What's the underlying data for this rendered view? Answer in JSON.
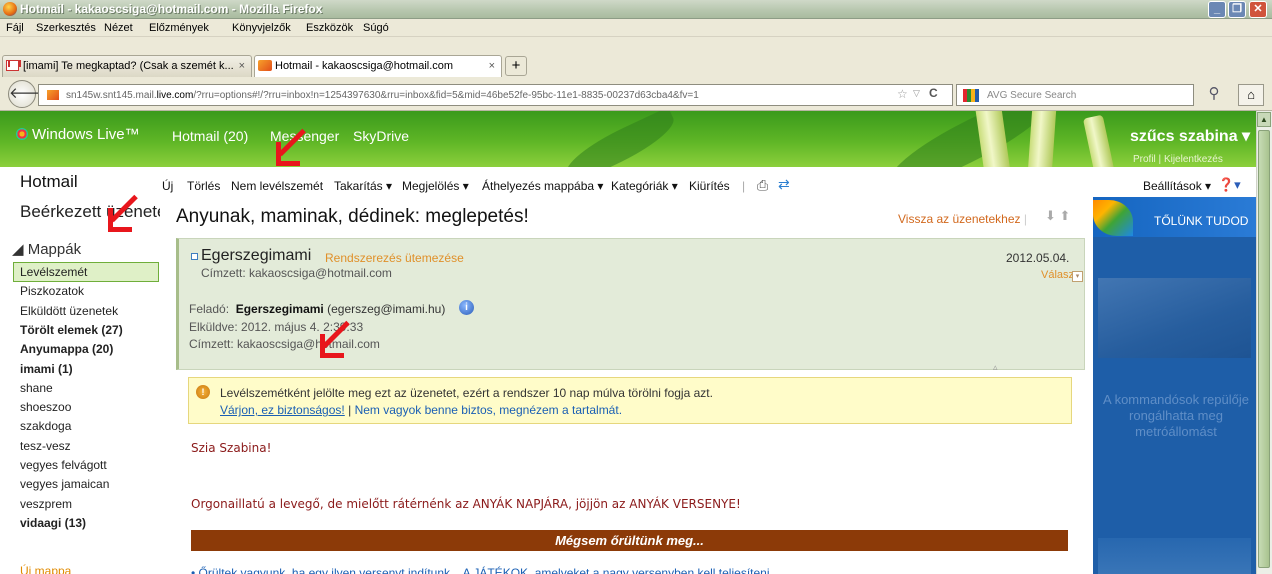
{
  "window": {
    "title": "Hotmail - kakaoscsiga@hotmail.com - Mozilla Firefox"
  },
  "menu": [
    "Fájl",
    "Szerkesztés",
    "Nézet",
    "Előzmények",
    "Könyvjelzők",
    "Eszközök",
    "Súgó"
  ],
  "tabs": [
    {
      "label": "[imami] Te megkaptad? (Csak a szemét k...",
      "close": "×"
    },
    {
      "label": "Hotmail - kakaoscsiga@hotmail.com",
      "close": "×"
    }
  ],
  "newtab": "+",
  "url": {
    "prefix": "sn145w.snt145.mail.",
    "domain": "live.com",
    "rest": "/?rru=options#!/?rru=inbox!n=1254397630&rru=inbox&fid=5&mid=46be52fe-95bc-11e1-8835-00237d63cba4&fv=1"
  },
  "search": {
    "placeholder": "AVG Secure Search"
  },
  "header": {
    "brand": "Windows Live™",
    "nav": [
      "Hotmail (20)",
      "Messenger",
      "SkyDrive"
    ],
    "user": "szűcs szabina",
    "links": "Profil | Kijelentkezés"
  },
  "toolbar": {
    "app": "Hotmail",
    "items": [
      "Új",
      "Törlés",
      "Nem levélszemét",
      "Takarítás ▾",
      "Megjelölés ▾",
      "Áthelyezés mappába ▾",
      "Kategóriák ▾",
      "Kiürítés"
    ],
    "settings": "Beállítások ▾"
  },
  "sidebar": {
    "inbox": "Beérkezett üzenetek",
    "folders_title": "◢ Mappák",
    "folders": [
      {
        "label": "Levélszemét",
        "bold": false
      },
      {
        "label": "Piszkozatok",
        "bold": false
      },
      {
        "label": "Elküldött üzenetek",
        "bold": false
      },
      {
        "label": "Törölt elemek (27)",
        "bold": true
      },
      {
        "label": "Anyumappa (20)",
        "bold": true
      },
      {
        "label": "imami (1)",
        "bold": true
      },
      {
        "label": "shane",
        "bold": false
      },
      {
        "label": "shoeszoo",
        "bold": false
      },
      {
        "label": "szakdoga",
        "bold": false
      },
      {
        "label": "tesz-vesz",
        "bold": false
      },
      {
        "label": "vegyes felvágott",
        "bold": false
      },
      {
        "label": "vegyes jamaican",
        "bold": false
      },
      {
        "label": "veszprem",
        "bold": false
      },
      {
        "label": "vidaagi (13)",
        "bold": true
      }
    ],
    "new_folder": "Új mappa"
  },
  "message": {
    "subject": "Anyunak, maminak, dédinek: meglepetés!",
    "back_link": "Vissza az üzenetekhez",
    "sender_name": "Egerszegimami",
    "schedule": "Rendszerezés ütemezése",
    "date": "2012.05.04.",
    "to_short": "Címzett: kakaoscsiga@hotmail.com",
    "reply": "Válasz",
    "from_label": "Feladó:",
    "from_name": "Egerszegimami",
    "from_email": "(egerszeg@imami.hu)",
    "sent": "Elküldve: 2012. május 4. 2:39:33",
    "to_full": "Címzett: kakaoscsiga@hotmail.com"
  },
  "warning": {
    "text": "Levélszemétként jelölte meg ezt az üzenetet, ezért a rendszer 10 nap múlva törölni fogja azt.",
    "safe_link": "Várjon, ez biztonságos!",
    "sep": "|",
    "unsure_link": "Nem vagyok benne biztos, megnézem a tartalmát."
  },
  "body": {
    "greeting": "Szia Szabina!",
    "para": "Orgonaillatú a levegő, de mielőtt rátérnénk az ANYÁK NAPJÁRA, jöjjön az ANYÁK VERSENYE!",
    "banner": "Mégsem őrültünk meg...",
    "tail": "• Őrültek vagyunk, ha egy ilyen versenyt indítunk... A JÁTÉKOK, amelyeket a nagy versenyben kell teljesíteni..."
  },
  "ad": {
    "title": "TŐLÜNK TUDOD",
    "headline": "A kommandósok repülője rongálhatta meg metróállomást"
  },
  "colors": {
    "accent_green": "#5fb626",
    "warning_bg": "#fffcc9",
    "banner_bg": "#8c3a08",
    "link": "#1a5fb4"
  }
}
